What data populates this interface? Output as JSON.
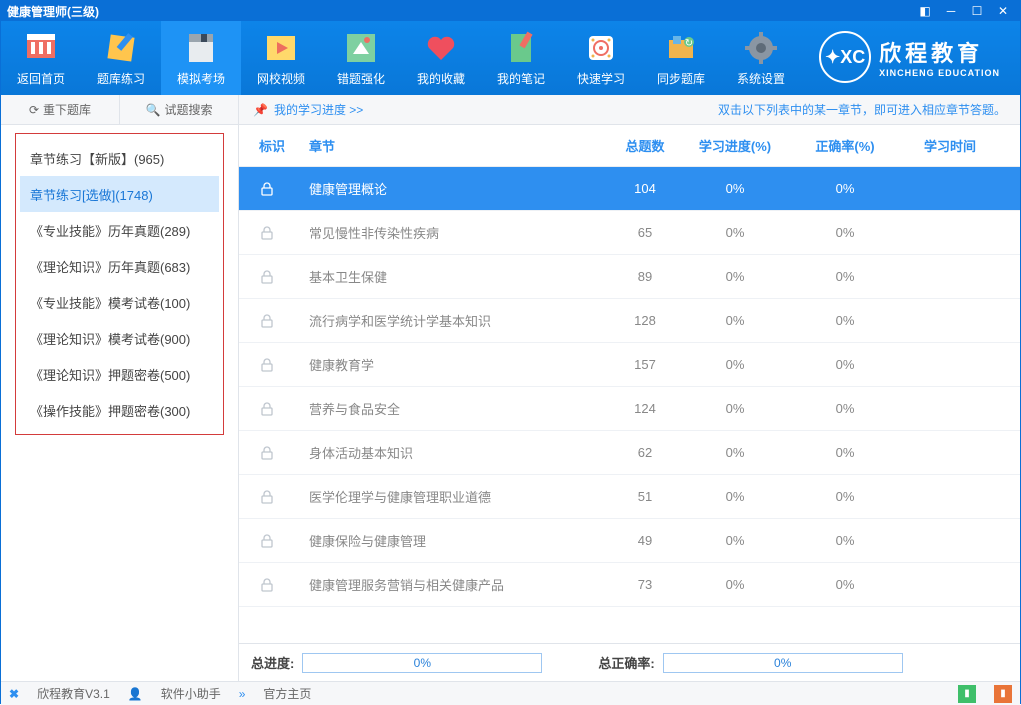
{
  "app_title": "健康管理师(三级)",
  "nav": [
    {
      "label": "返回首页"
    },
    {
      "label": "题库练习"
    },
    {
      "label": "模拟考场"
    },
    {
      "label": "网校视频"
    },
    {
      "label": "错题强化"
    },
    {
      "label": "我的收藏"
    },
    {
      "label": "我的笔记"
    },
    {
      "label": "快速学习"
    },
    {
      "label": "同步题库"
    },
    {
      "label": "系统设置"
    }
  ],
  "brand": {
    "name": "欣程教育",
    "sub": "XINCHENG EDUCATION",
    "abbr": "XC"
  },
  "toolbar": {
    "reload": "重下题库",
    "search": "试题搜索",
    "progress_link": "我的学习进度 >>",
    "hint": "双击以下列表中的某一章节，即可进入相应章节答题。"
  },
  "sidebar": {
    "items": [
      {
        "label": "章节练习【新版】(965)"
      },
      {
        "label": "章节练习[选做](1748)"
      },
      {
        "label": "《专业技能》历年真题(289)"
      },
      {
        "label": "《理论知识》历年真题(683)"
      },
      {
        "label": "《专业技能》模考试卷(100)"
      },
      {
        "label": "《理论知识》模考试卷(900)"
      },
      {
        "label": "《理论知识》押题密卷(500)"
      },
      {
        "label": "《操作技能》押题密卷(300)"
      }
    ],
    "active_index": 1
  },
  "table": {
    "headers": {
      "flag": "标识",
      "chapter": "章节",
      "total": "总题数",
      "progress": "学习进度(%)",
      "accuracy": "正确率(%)",
      "time": "学习时间"
    },
    "rows": [
      {
        "chapter": "健康管理概论",
        "total": "104",
        "progress": "0%",
        "accuracy": "0%"
      },
      {
        "chapter": "常见慢性非传染性疾病",
        "total": "65",
        "progress": "0%",
        "accuracy": "0%"
      },
      {
        "chapter": "基本卫生保健",
        "total": "89",
        "progress": "0%",
        "accuracy": "0%"
      },
      {
        "chapter": "流行病学和医学统计学基本知识",
        "total": "128",
        "progress": "0%",
        "accuracy": "0%"
      },
      {
        "chapter": "健康教育学",
        "total": "157",
        "progress": "0%",
        "accuracy": "0%"
      },
      {
        "chapter": "营养与食品安全",
        "total": "124",
        "progress": "0%",
        "accuracy": "0%"
      },
      {
        "chapter": "身体活动基本知识",
        "total": "62",
        "progress": "0%",
        "accuracy": "0%"
      },
      {
        "chapter": "医学伦理学与健康管理职业道德",
        "total": "51",
        "progress": "0%",
        "accuracy": "0%"
      },
      {
        "chapter": "健康保险与健康管理",
        "total": "49",
        "progress": "0%",
        "accuracy": "0%"
      },
      {
        "chapter": "健康管理服务营销与相关健康产品",
        "total": "73",
        "progress": "0%",
        "accuracy": "0%"
      }
    ],
    "active_row": 0
  },
  "summary": {
    "total_progress_label": "总进度:",
    "total_progress_value": "0%",
    "total_accuracy_label": "总正确率:",
    "total_accuracy_value": "0%"
  },
  "statusbar": {
    "app": "欣程教育V3.1",
    "helper": "软件小助手",
    "home": "官方主页"
  }
}
